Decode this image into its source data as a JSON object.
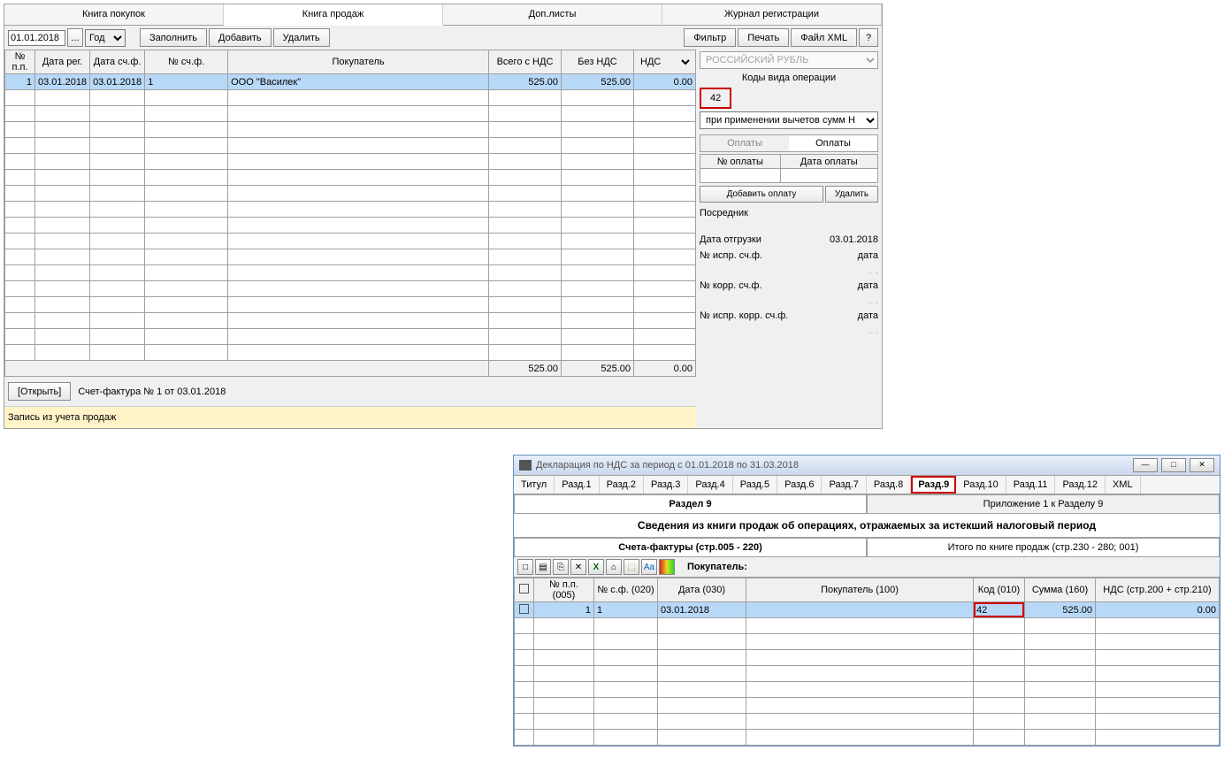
{
  "main": {
    "tabs": [
      "Книга покупок",
      "Книга продаж",
      "Доп.листы",
      "Журнал регистрации"
    ],
    "activeTab": 1,
    "date": "01.01.2018",
    "period": "Год",
    "btns": {
      "fill": "Заполнить",
      "add": "Добавить",
      "del": "Удалить",
      "filter": "Фильтр",
      "print": "Печать",
      "xml": "Файл XML",
      "help": "?"
    },
    "grid": {
      "cols": [
        "№ п.п.",
        "Дата рег.",
        "Дата сч.ф.",
        "№ сч.ф.",
        "Покупатель",
        "Всего с НДС",
        "Без НДС",
        "НДС"
      ],
      "row": {
        "n": "1",
        "dreg": "03.01.2018",
        "dsf": "03.01.2018",
        "nsf": "1",
        "buyer": "ООО \"Василек\"",
        "total": "525.00",
        "noVat": "525.00",
        "vat": "0.00"
      }
    },
    "totals": {
      "total": "525.00",
      "noVat": "525.00",
      "vat": "0.00"
    },
    "open": "[Открыть]",
    "invoice": "Счет-фактура № 1 от 03.01.2018",
    "status": "Запись из учета продаж"
  },
  "right": {
    "currency": "РОССИЙСКИЙ РУБЛЬ",
    "opCodesLabel": "Коды вида операции",
    "opCode": "42",
    "deduction": "при применении вычетов сумм Н",
    "payTabs": [
      "Оплаты",
      "Оплаты"
    ],
    "payCols": [
      "№ оплаты",
      "Дата оплаты"
    ],
    "addPay": "Добавить оплату",
    "delPay": "Удалить",
    "mediator": "Посредник",
    "shipDateLabel": "Дата отгрузки",
    "shipDate": "03.01.2018",
    "fields": [
      {
        "l": "№ испр. сч.ф.",
        "r": "дата"
      },
      {
        "l": "№ корр. сч.ф.",
        "r": "дата"
      },
      {
        "l": "№ испр. корр. сч.ф.",
        "r": "дата"
      }
    ]
  },
  "win2": {
    "title": "Декларация по НДС за период с 01.01.2018 по 31.03.2018",
    "tabs": [
      "Титул",
      "Разд.1",
      "Разд.2",
      "Разд.3",
      "Разд.4",
      "Разд.5",
      "Разд.6",
      "Разд.7",
      "Разд.8",
      "Разд.9",
      "Разд.10",
      "Разд.11",
      "Разд.12",
      "XML"
    ],
    "activeTab": 9,
    "subtabs": [
      "Раздел 9",
      "Приложение 1 к Разделу 9"
    ],
    "heading": "Сведения из книги продаж об операциях, отражаемых за истекший налоговый период",
    "subheads": [
      "Счета-фактуры (стр.005 - 220)",
      "Итого по книге продаж (стр.230 - 280; 001)"
    ],
    "buyerLabel": "Покупатель:",
    "cols": [
      "",
      "№ п.п. (005)",
      "№ с.ф. (020)",
      "Дата (030)",
      "Покупатель (100)",
      "Код (010)",
      "Сумма (160)",
      "НДС (стр.200 + стр.210)"
    ],
    "row": {
      "n": "1",
      "nsf": "1",
      "date": "03.01.2018",
      "buyer": "",
      "code": "42",
      "sum": "525.00",
      "vat": "0.00"
    },
    "icons": [
      "□",
      "▤",
      "⎘",
      "✕",
      "X",
      "⌂",
      "⬚",
      "Aa",
      "▬"
    ]
  }
}
